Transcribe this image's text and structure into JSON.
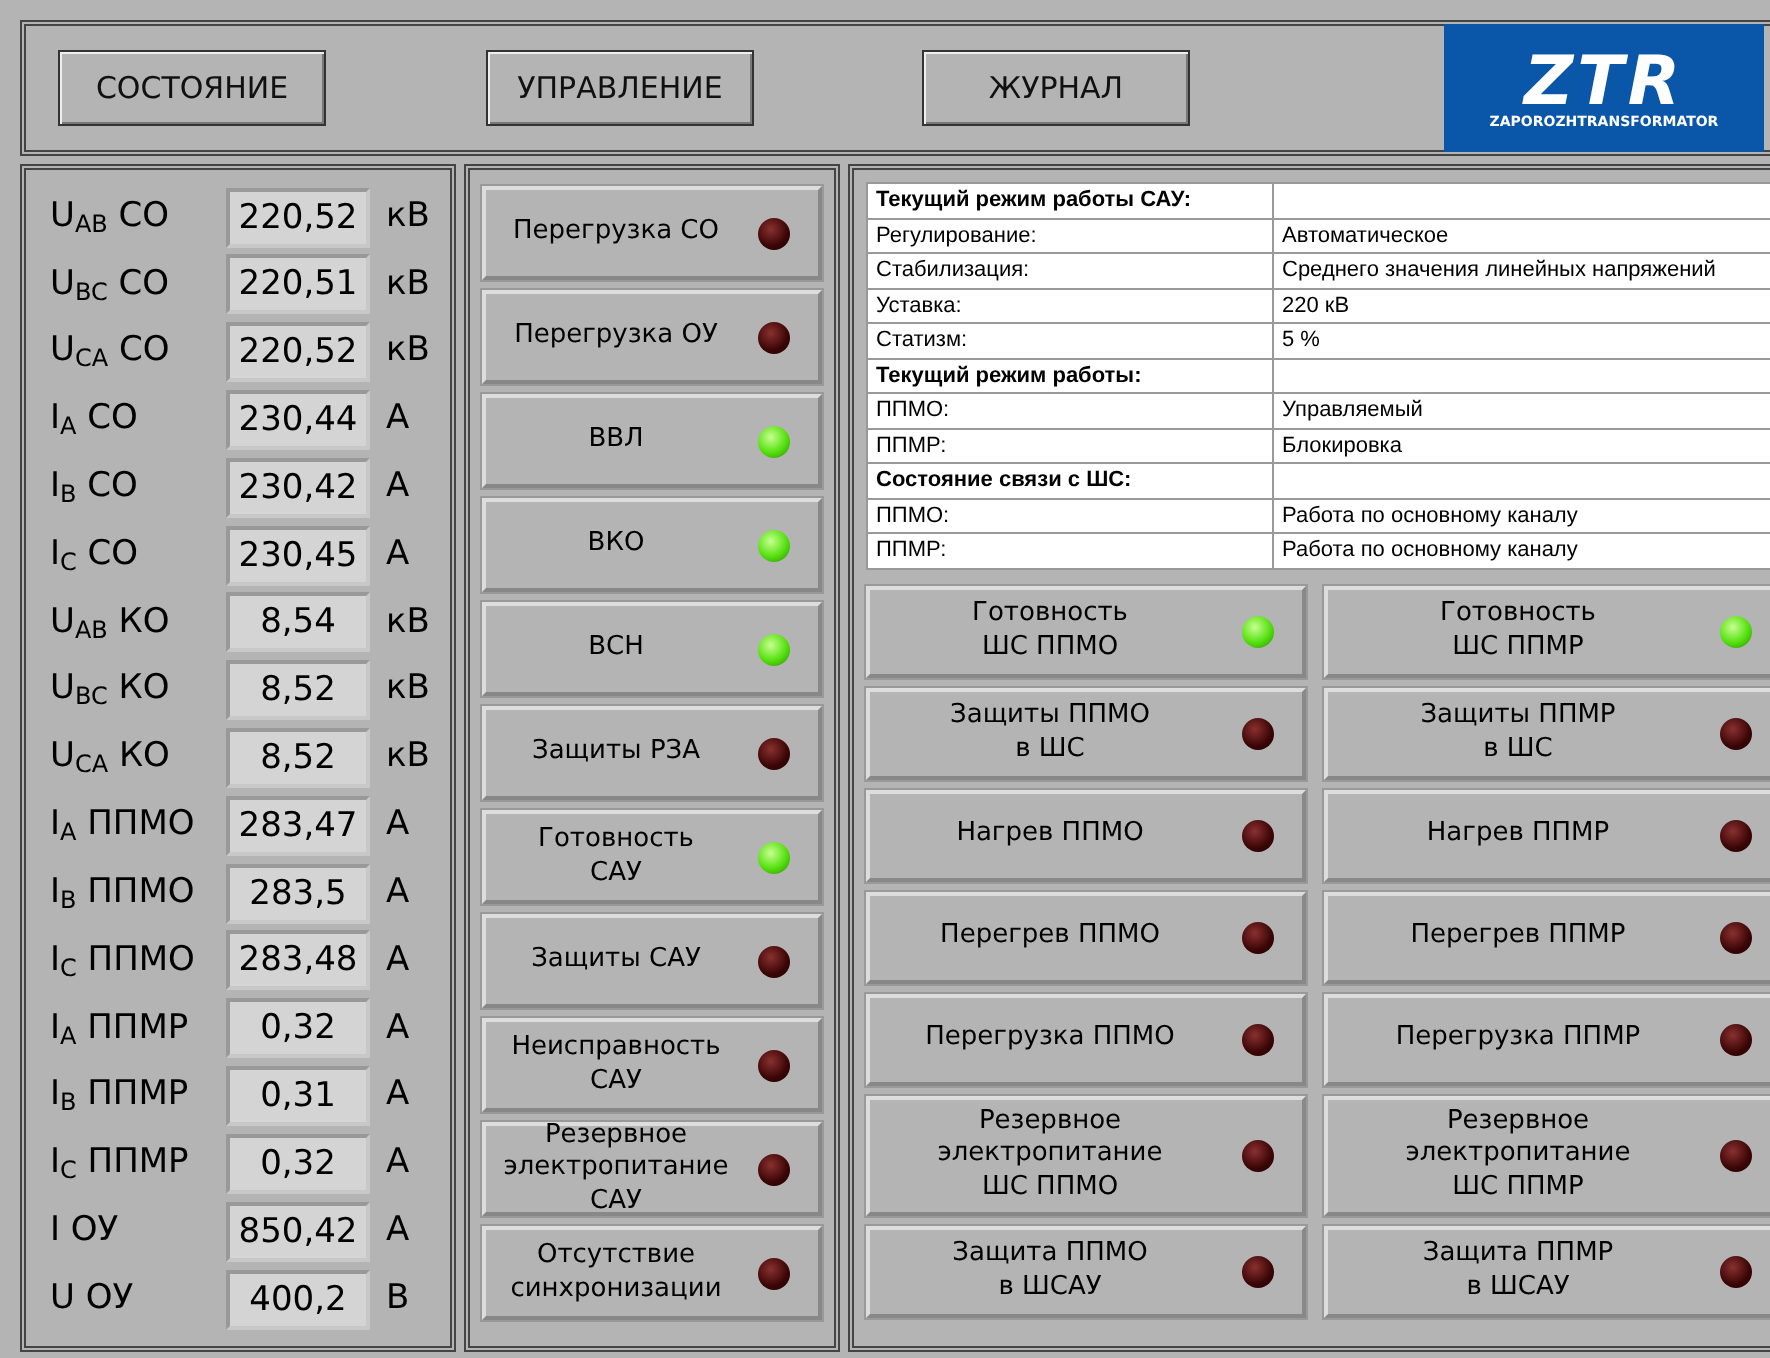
{
  "nav_buttons": [
    "СОСТОЯНИЕ",
    "УПРАВЛЕНИЕ",
    "ЖУРНАЛ"
  ],
  "logo": {
    "mark": "ZTR",
    "caption": "ZAPOROZHTRANSFORMATOR"
  },
  "measurements": [
    {
      "label": "U$_{AB}$ СО",
      "value": "220,52",
      "unit": "кВ"
    },
    {
      "label": "U$_{BC}$ СО",
      "value": "220,51",
      "unit": "кВ"
    },
    {
      "label": "U$_{CA}$ СО",
      "value": "220,52",
      "unit": "кВ"
    },
    {
      "label": "I$_{A}$ СО",
      "value": "230,44",
      "unit": "А"
    },
    {
      "label": "I$_{B}$ СО",
      "value": "230,42",
      "unit": "А"
    },
    {
      "label": "I$_{C}$ СО",
      "value": "230,45",
      "unit": "А"
    },
    {
      "label": "U$_{AB}$ КО",
      "value": "8,54",
      "unit": "кВ"
    },
    {
      "label": "U$_{BC}$ КО",
      "value": "8,52",
      "unit": "кВ"
    },
    {
      "label": "U$_{CA}$ КО",
      "value": "8,52",
      "unit": "кВ"
    },
    {
      "label": "I$_{A}$ ППМО",
      "value": "283,47",
      "unit": "А"
    },
    {
      "label": "I$_{B}$ ППМО",
      "value": "283,5",
      "unit": "А"
    },
    {
      "label": "I$_{C}$ ППМО",
      "value": "283,48",
      "unit": "А"
    },
    {
      "label": "I$_{A}$ ППМР",
      "value": "0,32",
      "unit": "А"
    },
    {
      "label": "I$_{B}$ ППМР",
      "value": "0,31",
      "unit": "А"
    },
    {
      "label": "I$_{C}$ ППМР",
      "value": "0,32",
      "unit": "А"
    },
    {
      "label": "I ОУ",
      "value": "850,42",
      "unit": "А"
    },
    {
      "label": "U ОУ",
      "value": "400,2",
      "unit": "В"
    }
  ],
  "indicators": [
    {
      "label": "Перегрузка СО",
      "on": false
    },
    {
      "label": "Перегрузка ОУ",
      "on": false
    },
    {
      "label": "ВВЛ",
      "on": true
    },
    {
      "label": "ВКО",
      "on": true
    },
    {
      "label": "ВСН",
      "on": true
    },
    {
      "label": "Защиты РЗА",
      "on": false
    },
    {
      "label": "Готовность\nСАУ",
      "on": true
    },
    {
      "label": "Защиты САУ",
      "on": false
    },
    {
      "label": "Неисправность\nСАУ",
      "on": false
    },
    {
      "label": "Резервное\nэлектропитание\nСАУ",
      "on": false
    },
    {
      "label": "Отсутствие\nсинхронизации",
      "on": false
    }
  ],
  "status_table": [
    {
      "kind": "header",
      "label": "Текущий режим работы САУ:"
    },
    {
      "kind": "row",
      "label": "Регулирование:",
      "value": "Автоматическое"
    },
    {
      "kind": "row",
      "label": "Стабилизация:",
      "value": "Среднего значения линейных напряжений"
    },
    {
      "kind": "row",
      "label": "Уставка:",
      "value": "220 кВ"
    },
    {
      "kind": "row",
      "label": "Статизм:",
      "value": "5 %"
    },
    {
      "kind": "header",
      "label": "Текущий режим работы:"
    },
    {
      "kind": "row",
      "label": "ППМО:",
      "value": "Управляемый"
    },
    {
      "kind": "row",
      "label": "ППМР:",
      "value": "Блокировка"
    },
    {
      "kind": "header",
      "label": "Состояние связи с ШС:"
    },
    {
      "kind": "row",
      "label": "ППМО:",
      "value": "Работа по основному каналу"
    },
    {
      "kind": "row",
      "label": "ППМР:",
      "value": "Работа по основному каналу"
    }
  ],
  "converter_indicators": [
    {
      "label": "Готовность\nШС ППМО",
      "on": true
    },
    {
      "label": "Готовность\nШС ППМР",
      "on": true
    },
    {
      "label": "Защиты ППМО\nв ШС",
      "on": false
    },
    {
      "label": "Защиты ППМР\nв ШС",
      "on": false
    },
    {
      "label": "Нагрев ППМО",
      "on": false
    },
    {
      "label": "Нагрев ППМР",
      "on": false
    },
    {
      "label": "Перегрев ППМО",
      "on": false
    },
    {
      "label": "Перегрев ППМР",
      "on": false
    },
    {
      "label": "Перегрузка ППМО",
      "on": false
    },
    {
      "label": "Перегрузка ППМР",
      "on": false
    },
    {
      "label": "Резервное\nэлектропитание\nШС ППМО",
      "on": false
    },
    {
      "label": "Резервное\nэлектропитание\nШС ППМР",
      "on": false
    },
    {
      "label": "Защита ППМО\nв ШСАУ",
      "on": false
    },
    {
      "label": "Защита ППМР\nв ШСАУ",
      "on": false
    }
  ]
}
